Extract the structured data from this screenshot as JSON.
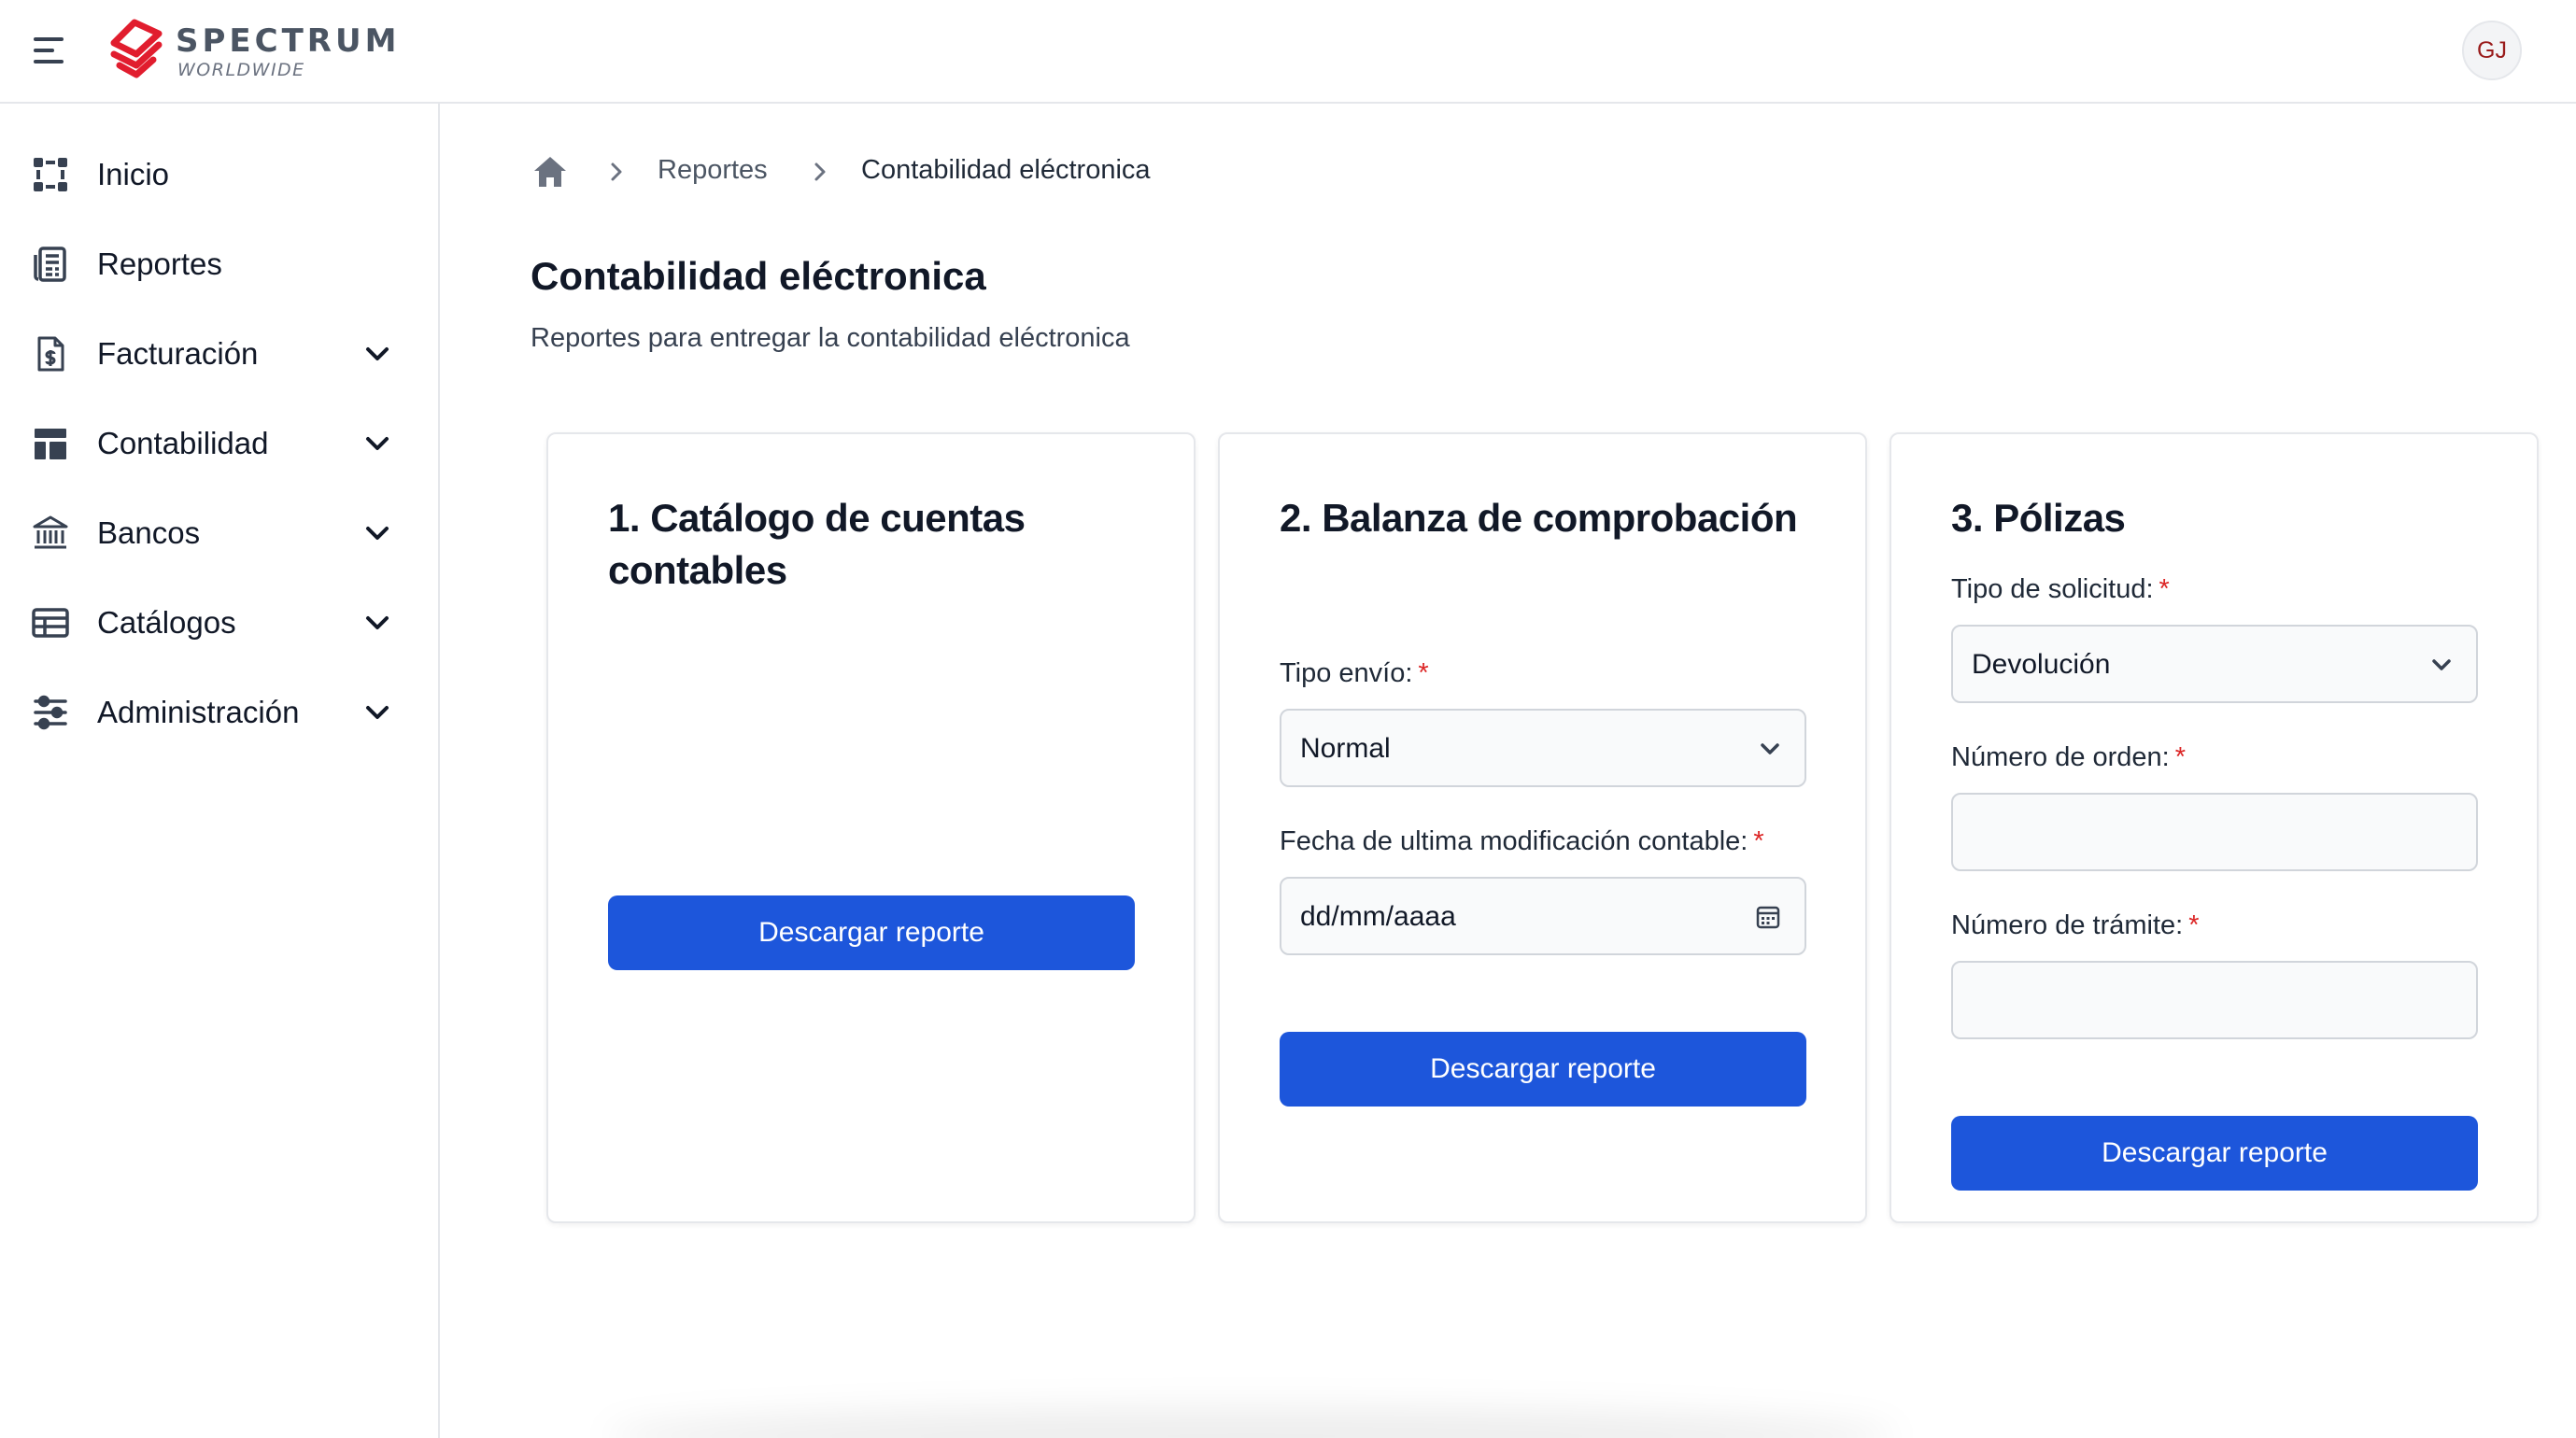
{
  "app": {
    "logo_title": "SPECTRUM",
    "logo_subtitle": "WORLDWIDE",
    "user_initials": "GJ",
    "brand_color": "#e11d2e",
    "accent_color": "#1d56db"
  },
  "sidebar": {
    "items": [
      {
        "label": "Inicio",
        "icon": "grid-dots-icon",
        "expandable": false
      },
      {
        "label": "Reportes",
        "icon": "report-sheet-icon",
        "expandable": false
      },
      {
        "label": "Facturación",
        "icon": "invoice-dollar-icon",
        "expandable": true
      },
      {
        "label": "Contabilidad",
        "icon": "layout-icon",
        "expandable": true
      },
      {
        "label": "Bancos",
        "icon": "bank-icon",
        "expandable": true
      },
      {
        "label": "Catálogos",
        "icon": "table-icon",
        "expandable": true
      },
      {
        "label": "Administración",
        "icon": "sliders-icon",
        "expandable": true
      }
    ]
  },
  "breadcrumb": {
    "home_icon": "home-icon",
    "items": [
      "Reportes",
      "Contabilidad eléctronica"
    ]
  },
  "page": {
    "title": "Contabilidad eléctronica",
    "subtitle": "Reportes para entregar la contabilidad eléctronica"
  },
  "cards": [
    {
      "title": "1. Catálogo de cuentas contables",
      "button_label": "Descargar reporte"
    },
    {
      "title": "2. Balanza de comprobación",
      "tipo_envio_label": "Tipo envío:",
      "tipo_envio_value": "Normal",
      "fecha_label": "Fecha de ultima modificación contable:",
      "fecha_placeholder": "dd/mm/aaaa",
      "button_label": "Descargar reporte"
    },
    {
      "title": "3. Pólizas",
      "tipo_solicitud_label": "Tipo de solicitud:",
      "tipo_solicitud_value": "Devolución",
      "numero_orden_label": "Número de orden:",
      "numero_orden_value": "",
      "numero_tramite_label": "Número de trámite:",
      "numero_tramite_value": "",
      "button_label": "Descargar reporte"
    }
  ],
  "required_marker": "*"
}
